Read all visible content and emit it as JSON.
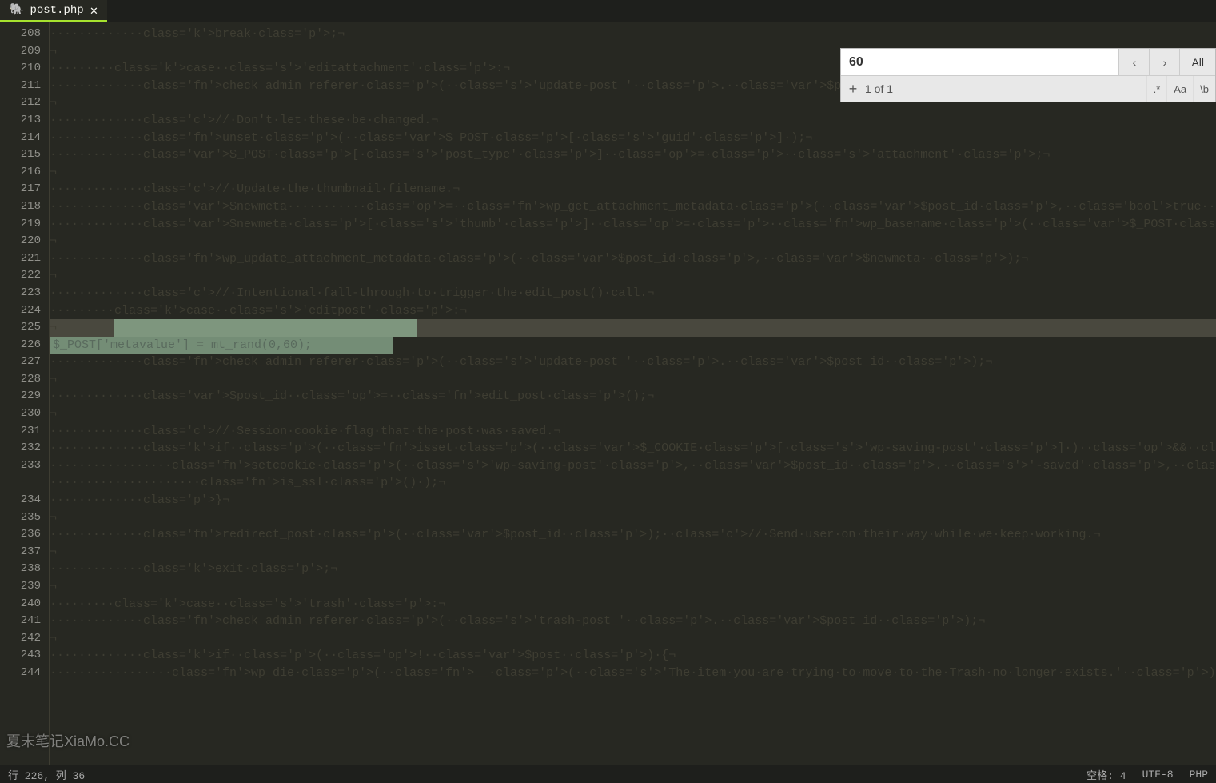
{
  "tab": {
    "filename": "post.php",
    "icon": "php-icon"
  },
  "find": {
    "query": "60",
    "count": "1 of 1",
    "all": "All",
    "regex": ".*",
    "case": "Aa",
    "word": "\\b"
  },
  "gutter": {
    "start": 208,
    "end": 244,
    "fold_lines": [
      232,
      243
    ]
  },
  "code_lines": [
    {
      "n": 208,
      "html": "            <span class='k'>break</span><span class='p'>;</span>"
    },
    {
      "n": 209,
      "html": ""
    },
    {
      "n": 210,
      "html": "        <span class='k'>case</span> <span class='s'>'editattachment'</span><span class='p'>:</span>"
    },
    {
      "n": 211,
      "html": "            <span class='fn'>check_admin_referer</span><span class='p'>(</span> <span class='s'>'update-post_'</span> <span class='p'>.</span> <span class='var'>$post_id</span> <span class='p'>);</span>"
    },
    {
      "n": 212,
      "html": ""
    },
    {
      "n": 213,
      "html": "            <span class='c'>// Don't let these be changed.</span>"
    },
    {
      "n": 214,
      "html": "            <span class='fn'>unset</span><span class='p'>(</span> <span class='var'>$_POST</span><span class='p'>[</span><span class='s'>'guid'</span><span class='p'>] );</span>"
    },
    {
      "n": 215,
      "html": "            <span class='var'>$_POST</span><span class='p'>[</span><span class='s'>'post_type'</span><span class='p'>] </span><span class='op'>=</span><span class='p'> </span><span class='s'>'attachment'</span><span class='p'>;</span>"
    },
    {
      "n": 216,
      "html": ""
    },
    {
      "n": 217,
      "html": "            <span class='c'>// Update the thumbnail filename.</span>"
    },
    {
      "n": 218,
      "html": "            <span class='var'>$newmeta</span>          <span class='op'>=</span> <span class='fn'>wp_get_attachment_metadata</span><span class='p'>(</span> <span class='var'>$post_id</span><span class='p'>,</span> <span class='bool'>true</span> <span class='p'>);</span>"
    },
    {
      "n": 219,
      "html": "            <span class='var'>$newmeta</span><span class='p'>[</span><span class='s'>'thumb'</span><span class='p'>] </span><span class='op'>=</span><span class='p'> </span><span class='fn'>wp_basename</span><span class='p'>(</span> <span class='var'>$_POST</span><span class='p'>[</span><span class='s'>'thumb'</span><span class='p'>] );</span>"
    },
    {
      "n": 220,
      "html": ""
    },
    {
      "n": 221,
      "html": "            <span class='fn'>wp_update_attachment_metadata</span><span class='p'>(</span> <span class='var'>$post_id</span><span class='p'>,</span> <span class='var'>$newmeta</span> <span class='p'>);</span>"
    },
    {
      "n": 222,
      "html": ""
    },
    {
      "n": 223,
      "html": "            <span class='c'>// Intentional fall-through to trigger the edit_post() call.</span>"
    },
    {
      "n": 224,
      "html": "        <span class='k'>case</span> <span class='s'>'editpost'</span><span class='p'>:</span>"
    },
    {
      "n": 225,
      "html": "",
      "selection": true,
      "sel_from": 0,
      "sel_to": 1372
    },
    {
      "n": 226,
      "html": "",
      "inserted": true,
      "ins_text": "$_POST['metavalue'] = mt_rand(0,60);"
    },
    {
      "n": 227,
      "html": "            <span class='fn'>check_admin_referer</span><span class='p'>(</span> <span class='s'>'update-post_'</span> <span class='p'>.</span> <span class='var'>$post_id</span> <span class='p'>);</span>"
    },
    {
      "n": 228,
      "html": ""
    },
    {
      "n": 229,
      "html": "            <span class='var'>$post_id</span> <span class='op'>=</span> <span class='fn'>edit_post</span><span class='p'>();</span>"
    },
    {
      "n": 230,
      "html": ""
    },
    {
      "n": 231,
      "html": "            <span class='c'>// Session cookie flag that the post was saved.</span>"
    },
    {
      "n": 232,
      "html": "            <span class='k'>if</span> <span class='p'>(</span> <span class='fn'>isset</span><span class='p'>(</span> <span class='var'>$_COOKIE</span><span class='p'>[</span><span class='s'>'wp-saving-post'</span><span class='p'>] )</span> <span class='op'>&amp;&amp;</span> <span class='var'>$_COOKIE</span><span class='p'>[</span><span class='s'>'wp-saving-post'</span><span class='p'>]</span> <span class='op'>===</span> <span class='var'>$post_id</span> <span class='p'>.</span> <span class='s'>'-check'</span> <span class='p'>) {</span>"
    },
    {
      "n": 233,
      "html": "                <span class='fn'>setcookie</span><span class='p'>(</span> <span class='s'>'wp-saving-post'</span><span class='p'>,</span> <span class='var'>$post_id</span> <span class='p'>.</span> <span class='s'>'-saved'</span><span class='p'>,</span> <span class='fn'>time</span><span class='p'>() </span><span class='op'>+</span><span class='p'> DAY_IN_SECONDS, ADMIN_COOKIE_PATH, COOKIE_DOMAIN,</span>"
    },
    {
      "n": -1,
      "html": "                    <span class='fn'>is_ssl</span><span class='p'>() );</span>"
    },
    {
      "n": 234,
      "html": "            <span class='p'>}</span>"
    },
    {
      "n": 235,
      "html": ""
    },
    {
      "n": 236,
      "html": "            <span class='fn'>redirect_post</span><span class='p'>(</span> <span class='var'>$post_id</span> <span class='p'>);</span> <span class='c'>// Send user on their way while we keep working.</span>"
    },
    {
      "n": 237,
      "html": ""
    },
    {
      "n": 238,
      "html": "            <span class='k'>exit</span><span class='p'>;</span>"
    },
    {
      "n": 239,
      "html": ""
    },
    {
      "n": 240,
      "html": "        <span class='k'>case</span> <span class='s'>'trash'</span><span class='p'>:</span>"
    },
    {
      "n": 241,
      "html": "            <span class='fn'>check_admin_referer</span><span class='p'>(</span> <span class='s'>'trash-post_'</span> <span class='p'>.</span> <span class='var'>$post_id</span> <span class='p'>);</span>"
    },
    {
      "n": 242,
      "html": ""
    },
    {
      "n": 243,
      "html": "            <span class='k'>if</span> <span class='p'>(</span> <span class='op'>!</span> <span class='var'>$post</span> <span class='p'>) {</span>"
    },
    {
      "n": 244,
      "html": "                <span class='fn'>wp_die</span><span class='p'>(</span> <span class='fn'>__</span><span class='p'>(</span> <span class='s'>'The item you are trying to move to the Trash no longer exists.'</span> <span class='p'>) );</span>"
    }
  ],
  "whitespace_dots": "·",
  "newline_mark": "¬",
  "status": {
    "pos_label": "行 226, 列 36",
    "tab": "空格: 4",
    "encoding": "UTF-8",
    "lang": "PHP"
  },
  "watermark": "夏末笔记XiaMo.CC"
}
